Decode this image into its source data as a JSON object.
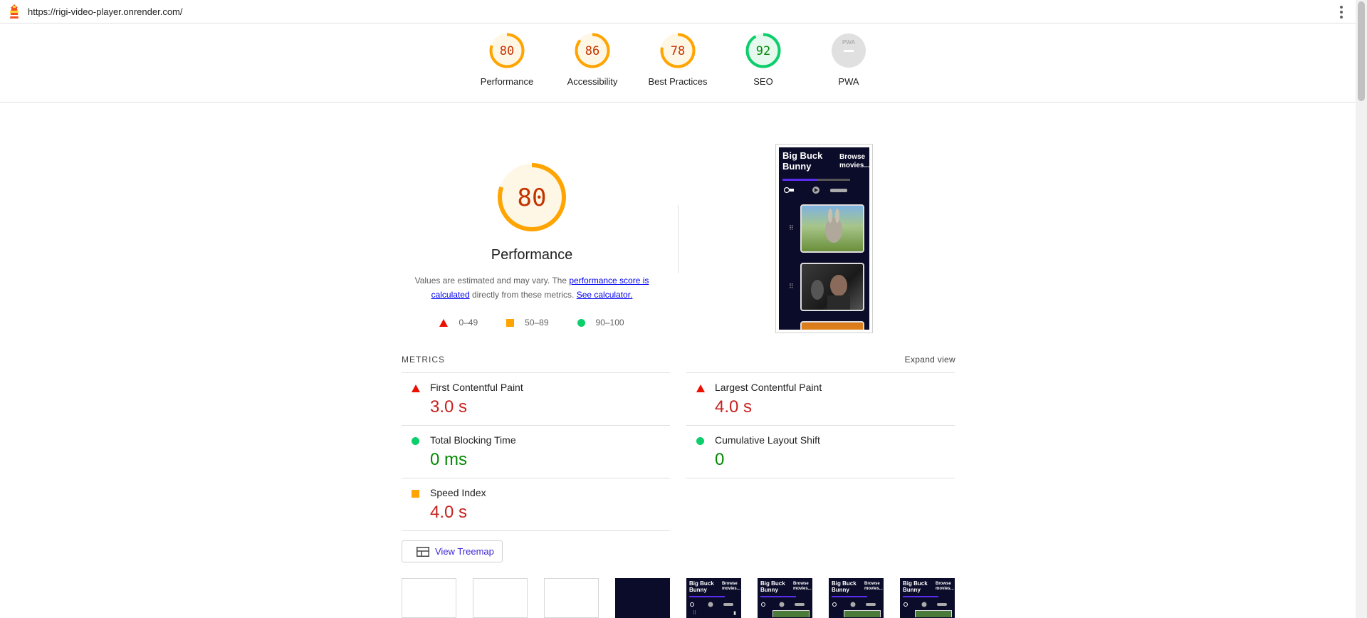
{
  "header": {
    "url": "https://rigi-video-player.onrender.com/",
    "logo_icon": "lighthouse-icon"
  },
  "gauges": [
    {
      "label": "Performance",
      "score": "80",
      "value": 80,
      "color": "#ffa400"
    },
    {
      "label": "Accessibility",
      "score": "86",
      "value": 86,
      "color": "#ffa400"
    },
    {
      "label": "Best Practices",
      "score": "78",
      "value": 78,
      "color": "#ffa400"
    },
    {
      "label": "SEO",
      "score": "92",
      "value": 92,
      "color": "#0cce6b"
    },
    {
      "label": "PWA",
      "score": "",
      "value": null,
      "color": "#9e9e9e",
      "badge_text": "PWA"
    }
  ],
  "performance": {
    "score": "80",
    "title": "Performance",
    "desc_prefix": "Values are estimated and may vary. The ",
    "link_score": "performance score is calculated",
    "desc_mid": " directly from these metrics. ",
    "link_calculator": "See calculator.",
    "legend": {
      "fail": "0–49",
      "average": "50–89",
      "pass": "90–100"
    }
  },
  "screenshot": {
    "title": "Big Buck Bunny",
    "browse": "Browse movies..."
  },
  "metrics": {
    "heading": "METRICS",
    "expand": "Expand view",
    "items": [
      {
        "name": "First Contentful Paint",
        "value": "3.0 s",
        "status": "fail"
      },
      {
        "name": "Largest Contentful Paint",
        "value": "4.0 s",
        "status": "fail"
      },
      {
        "name": "Total Blocking Time",
        "value": "0 ms",
        "status": "pass"
      },
      {
        "name": "Cumulative Layout Shift",
        "value": "0",
        "status": "pass"
      },
      {
        "name": "Speed Index",
        "value": "4.0 s",
        "status": "average"
      }
    ]
  },
  "treemap_button": "View Treemap",
  "filmstrip": {
    "title": "Big Buck Bunny",
    "browse": "Browse movies..."
  },
  "colors": {
    "fail": "#c7221f",
    "average": "#ffa400",
    "pass": "#008a00",
    "link": "#3b28d6"
  }
}
